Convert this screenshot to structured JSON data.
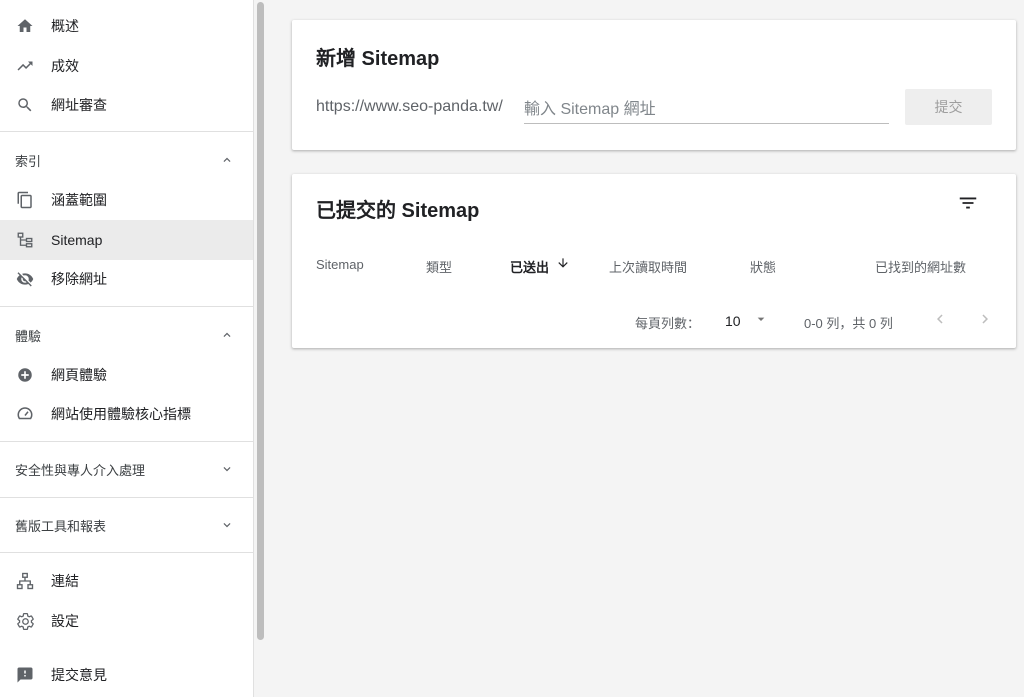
{
  "sidebar": {
    "top_items": [
      {
        "label": "概述",
        "icon": "home-icon"
      },
      {
        "label": "成效",
        "icon": "trending-up-icon"
      },
      {
        "label": "網址審查",
        "icon": "search-icon"
      }
    ],
    "sections": [
      {
        "label": "索引",
        "expanded": true,
        "items": [
          {
            "label": "涵蓋範圍",
            "icon": "copy-icon"
          },
          {
            "label": "Sitemap",
            "icon": "sitemap-icon",
            "active": true
          },
          {
            "label": "移除網址",
            "icon": "eye-off-icon"
          }
        ]
      },
      {
        "label": "體驗",
        "expanded": true,
        "items": [
          {
            "label": "網頁體驗",
            "icon": "plus-circle-icon"
          },
          {
            "label": "網站使用體驗核心指標",
            "icon": "speedometer-icon"
          }
        ]
      },
      {
        "label": "安全性與專人介入處理",
        "expanded": false
      },
      {
        "label": "舊版工具和報表",
        "expanded": false
      }
    ],
    "bottom_items": [
      {
        "label": "連結",
        "icon": "link-network-icon"
      },
      {
        "label": "設定",
        "icon": "gear-icon"
      },
      {
        "label": "提交意見",
        "icon": "feedback-icon"
      }
    ]
  },
  "add_sitemap": {
    "title": "新增 Sitemap",
    "url_prefix": "https://www.seo-panda.tw/",
    "input_placeholder": "輸入 Sitemap 網址",
    "input_value": "",
    "submit_label": "提交"
  },
  "submitted": {
    "title": "已提交的 Sitemap",
    "columns": [
      "Sitemap",
      "類型",
      "已送出",
      "上次讀取時間",
      "狀態",
      "已找到的網址數"
    ],
    "sorted_column": "已送出",
    "rows": [],
    "footer": {
      "rows_per_page_label": "每頁列數：",
      "rows_per_page_value": "10",
      "range_text": "0-0 列，共 0 列"
    }
  },
  "colors": {
    "background": "#f4f4f4",
    "active_nav": "#ebebeb",
    "text": "#202124",
    "secondary_text": "#5f6368"
  }
}
